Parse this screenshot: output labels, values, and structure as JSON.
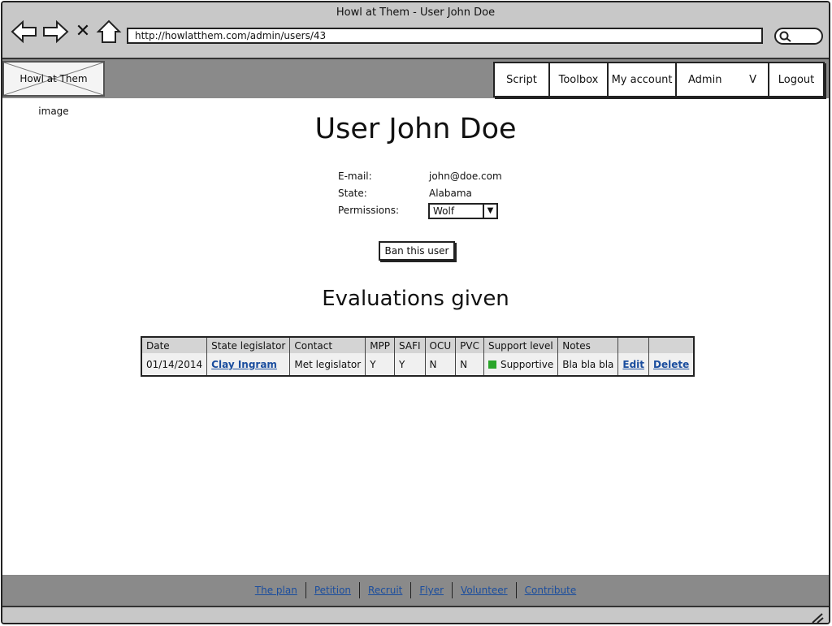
{
  "window": {
    "title": "Howl at Them - User John Doe",
    "url": "http://howlatthem.com/admin/users/43"
  },
  "header": {
    "logo_text": "Howl at Them image",
    "nav": {
      "script": "Script",
      "toolbox": "Toolbox",
      "my_account": "My account",
      "admin": "Admin",
      "admin_caret": "V",
      "logout": "Logout"
    }
  },
  "main": {
    "title": "User John Doe",
    "info": {
      "email_label": "E-mail:",
      "email_value": "john@doe.com",
      "state_label": "State:",
      "state_value": "Alabama",
      "permissions_label": "Permissions:",
      "permissions_value": "Wolf"
    },
    "ban_button": "Ban this user",
    "evaluations_title": "Evaluations given",
    "table": {
      "headers": [
        "Date",
        "State legislator",
        "Contact",
        "MPP",
        "SAFI",
        "OCU",
        "PVC",
        "Support level",
        "Notes",
        "",
        ""
      ],
      "rows": [
        {
          "date": "01/14/2014",
          "legislator": "Clay Ingram",
          "contact": "Met legislator",
          "mpp": "Y",
          "safi": "Y",
          "ocu": "N",
          "pvc": "N",
          "support_level": "Supportive",
          "support_color": "#2aa52a",
          "notes": "Bla bla bla",
          "edit": "Edit",
          "delete": "Delete"
        }
      ]
    }
  },
  "footer": {
    "links": [
      "The plan",
      "Petition",
      "Recruit",
      "Flyer",
      "Volunteer",
      "Contribute"
    ]
  },
  "colors": {
    "link": "#1a4d9e",
    "header_band": "#8a8a8a",
    "chrome": "#c8c8c8"
  }
}
